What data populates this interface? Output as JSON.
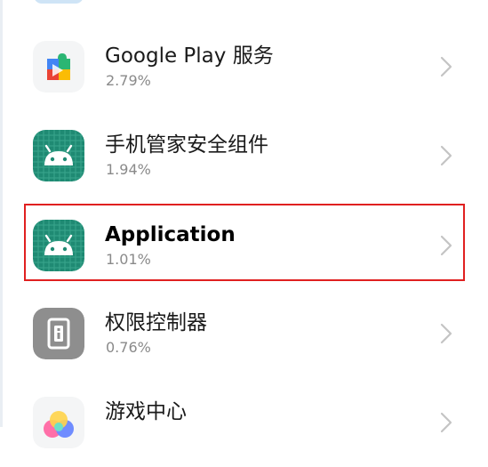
{
  "apps": [
    {
      "name": "Google Play 服务",
      "usage": "2.79%",
      "icon": "google-play-services-icon",
      "highlighted": false
    },
    {
      "name": "手机管家安全组件",
      "usage": "1.94%",
      "icon": "android-icon",
      "highlighted": false
    },
    {
      "name": "Application",
      "usage": "1.01%",
      "icon": "android-icon",
      "highlighted": true
    },
    {
      "name": "权限控制器",
      "usage": "0.76%",
      "icon": "permission-controller-icon",
      "highlighted": false
    },
    {
      "name": "游戏中心",
      "usage": "",
      "icon": "game-center-icon",
      "highlighted": false
    }
  ],
  "colors": {
    "android_icon_bg": "#1f8a73",
    "highlight_border": "#e02020",
    "usage_text": "#8a8a8a",
    "chevron": "#c4c4c4"
  }
}
